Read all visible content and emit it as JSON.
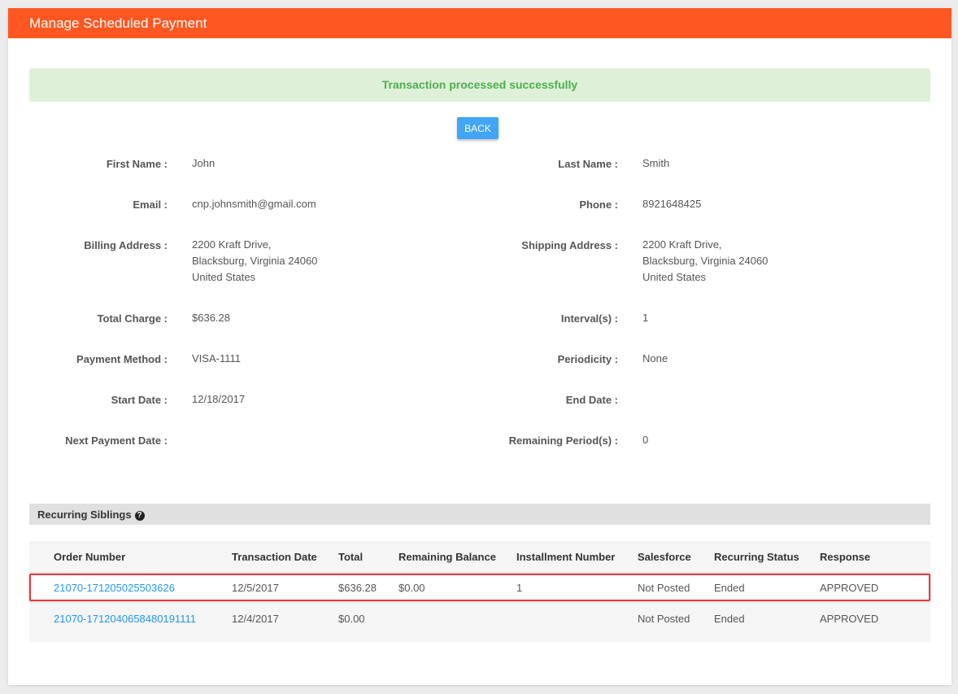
{
  "header": {
    "title": "Manage Scheduled Payment"
  },
  "alert": {
    "message": "Transaction processed successfully"
  },
  "back_button": {
    "label": "BACK"
  },
  "fields": {
    "first_name": {
      "label": "First Name :",
      "value": "John"
    },
    "last_name": {
      "label": "Last Name :",
      "value": "Smith"
    },
    "email": {
      "label": "Email :",
      "value": "cnp.johnsmith@gmail.com"
    },
    "phone": {
      "label": "Phone :",
      "value": "8921648425"
    },
    "billing_address": {
      "label": "Billing Address :",
      "line1": "2200 Kraft Drive,",
      "line2": "Blacksburg, Virginia 24060",
      "line3": "United States"
    },
    "shipping_address": {
      "label": "Shipping Address :",
      "line1": "2200 Kraft Drive,",
      "line2": "Blacksburg, Virginia 24060",
      "line3": "United States"
    },
    "total_charge": {
      "label": "Total Charge :",
      "value": "$636.28"
    },
    "intervals": {
      "label": "Interval(s) :",
      "value": "1"
    },
    "payment_method": {
      "label": "Payment Method :",
      "value": "VISA-1111"
    },
    "periodicity": {
      "label": "Periodicity :",
      "value": "None"
    },
    "start_date": {
      "label": "Start Date :",
      "value": "12/18/2017"
    },
    "end_date": {
      "label": "End Date :",
      "value": ""
    },
    "next_payment_date": {
      "label": "Next Payment Date :",
      "value": ""
    },
    "remaining_periods": {
      "label": "Remaining Period(s) :",
      "value": "0"
    }
  },
  "siblings": {
    "title": "Recurring Siblings",
    "help_icon": "question-circle-icon",
    "columns": [
      "Order Number",
      "Transaction Date",
      "Total",
      "Remaining Balance",
      "Installment Number",
      "Salesforce",
      "Recurring Status",
      "Response"
    ],
    "rows": [
      [
        "21070-171205025503626",
        "12/5/2017",
        "$636.28",
        "$0.00",
        "1",
        "Not Posted",
        "Ended",
        "APPROVED"
      ],
      [
        "21070-1712040658480191111",
        "12/4/2017",
        "$0.00",
        "",
        "",
        "Not Posted",
        "Ended",
        "APPROVED"
      ]
    ]
  },
  "colors": {
    "header_bg": "#ff5722",
    "alert_bg": "#dff0d8",
    "alert_text": "#4caf50",
    "button_bg": "#42a5f5",
    "link": "#2196f3",
    "highlight_border": "#e53935"
  }
}
